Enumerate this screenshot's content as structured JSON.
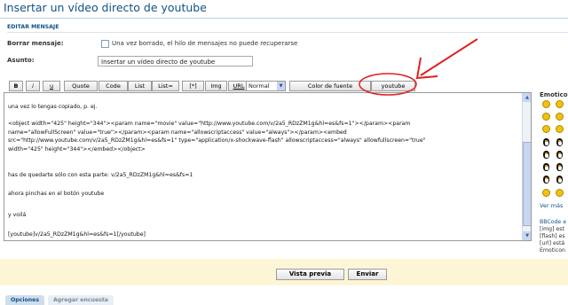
{
  "page": {
    "title": "Insertar un vídeo directo de youtube",
    "section_title": "EDITAR MENSAJE"
  },
  "form": {
    "delete_label": "Borrar mensaje:",
    "delete_text": "Una vez borrado, el hilo de mensajes no puede recuperarse",
    "subject_label": "Asunto:",
    "subject_value": "Insertar un vídeo directo de youtube"
  },
  "toolbar": {
    "buttons": [
      "B",
      "i",
      "u",
      "Quote",
      "Code",
      "List",
      "List=",
      "[*]",
      "Img",
      "URL"
    ],
    "font_size": "Normal",
    "font_color": "Color de fuente",
    "youtube": "youtube"
  },
  "message": {
    "lines": [
      "una vez lo tengas copiado, p. ej.",
      "",
      "<object width=\"425\" height=\"344\"><param name=\"movie\" value=\"http://www.youtube.com/v/2a5_RDzZM1g&hl=es&fs=1\"></param><param",
      "name=\"allowFullScreen\" value=\"true\"></param><param name=\"allowscriptaccess\" value=\"always\"></param><embed",
      "src=\"http://www.youtube.com/v/2a5_RDzZM1g&hl=es&fs=1\" type=\"application/x-shockwave-flash\" allowscriptaccess=\"always\" allowfullscreen=\"true\"",
      "width=\"425\" height=\"344\"></embed></object>",
      "",
      "has de quedarte sólo con esta parte:   v/2a5_RDzZM1g&hl=es&fs=1",
      "",
      "ahora pinchas en el botón youtube",
      "",
      "y voilá",
      "",
      "[youtube]v/2a5_RDzZM1g&hl=es&fs=1[/youtube]"
    ]
  },
  "sidebar": {
    "emoticons_title": "Emotico",
    "more_link": "Ver más",
    "bbcode_lines": [
      "BBCode e",
      "[img] est",
      "[flash] es",
      "[url] está",
      "Emoticon"
    ]
  },
  "actions": {
    "preview": "Vista previa",
    "send": "Enviar"
  },
  "tabs": [
    "Opciones",
    "Agregar encuesta"
  ],
  "colors": {
    "link_blue": "#105289",
    "annotation_red": "#e02020",
    "panel_yellow": "#fdf6d6"
  }
}
